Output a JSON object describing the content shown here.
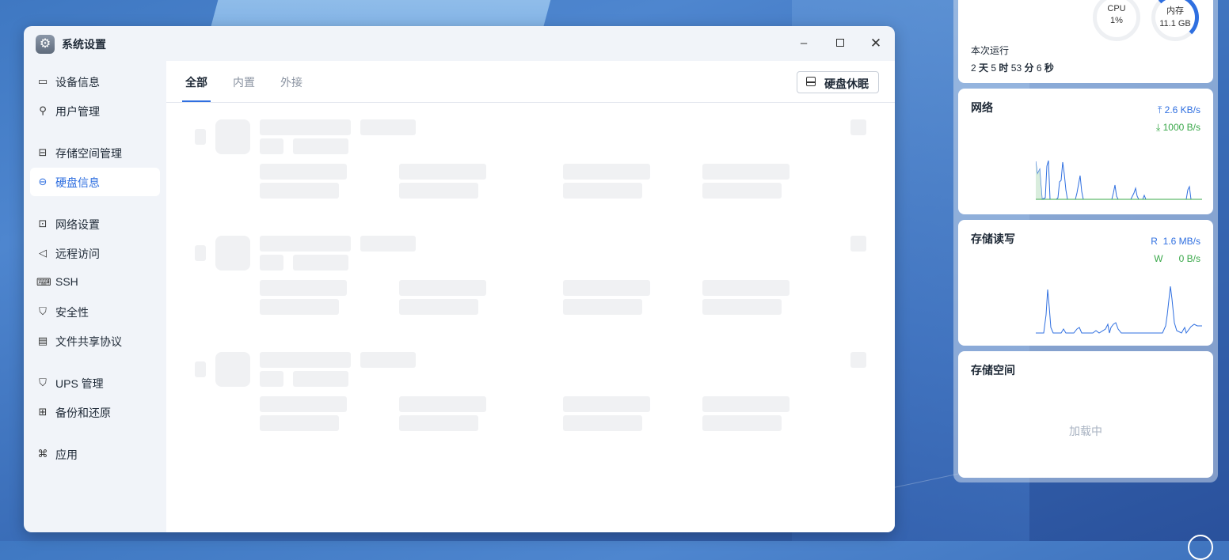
{
  "window": {
    "title": "系统设置",
    "minimize": "–",
    "close": "✕"
  },
  "sidebar": {
    "items": [
      {
        "label": "设备信息",
        "icon": "device-icon",
        "glyph": "▭"
      },
      {
        "label": "用户管理",
        "icon": "user-icon",
        "glyph": "⚲"
      },
      {
        "label": "存储空间管理",
        "icon": "storage-icon",
        "glyph": "⊟"
      },
      {
        "label": "硬盘信息",
        "icon": "disk-icon",
        "glyph": "⊖"
      },
      {
        "label": "网络设置",
        "icon": "network-icon",
        "glyph": "⊡"
      },
      {
        "label": "远程访问",
        "icon": "send-icon",
        "glyph": "◁"
      },
      {
        "label": "SSH",
        "icon": "terminal-icon",
        "glyph": "⌨"
      },
      {
        "label": "安全性",
        "icon": "shield-icon",
        "glyph": "⛉"
      },
      {
        "label": "文件共享协议",
        "icon": "file-icon",
        "glyph": "▤"
      },
      {
        "label": "UPS 管理",
        "icon": "ups-shield-icon",
        "glyph": "⛉"
      },
      {
        "label": "备份和还原",
        "icon": "backup-icon",
        "glyph": "⊞"
      },
      {
        "label": "应用",
        "icon": "apps-icon",
        "glyph": "⌘"
      }
    ],
    "active_index": 3
  },
  "tabs": [
    "全部",
    "内置",
    "外接"
  ],
  "active_tab": 0,
  "sleep_button": "硬盘休眠",
  "widgets": {
    "cpu": {
      "label": "CPU",
      "value": "1%"
    },
    "memory": {
      "label": "内存",
      "value": "11.1 GB"
    },
    "uptime": {
      "label": "本次运行",
      "days": "2",
      "days_unit": "天",
      "hours": "5",
      "hours_unit": "时",
      "minutes": "53",
      "minutes_unit": "分",
      "seconds": "6",
      "seconds_unit": "秒"
    },
    "network": {
      "title": "网络",
      "up": "2.6 KB/s",
      "down": "1000 B/s"
    },
    "storage_io": {
      "title": "存储读写",
      "read_label": "R",
      "read": "1.6 MB/s",
      "write_label": "W",
      "write": "0 B/s"
    },
    "storage_space": {
      "title": "存储空间",
      "status": "加载中"
    }
  },
  "colors": {
    "accent": "#2f6fe0",
    "green": "#3aa84a"
  }
}
